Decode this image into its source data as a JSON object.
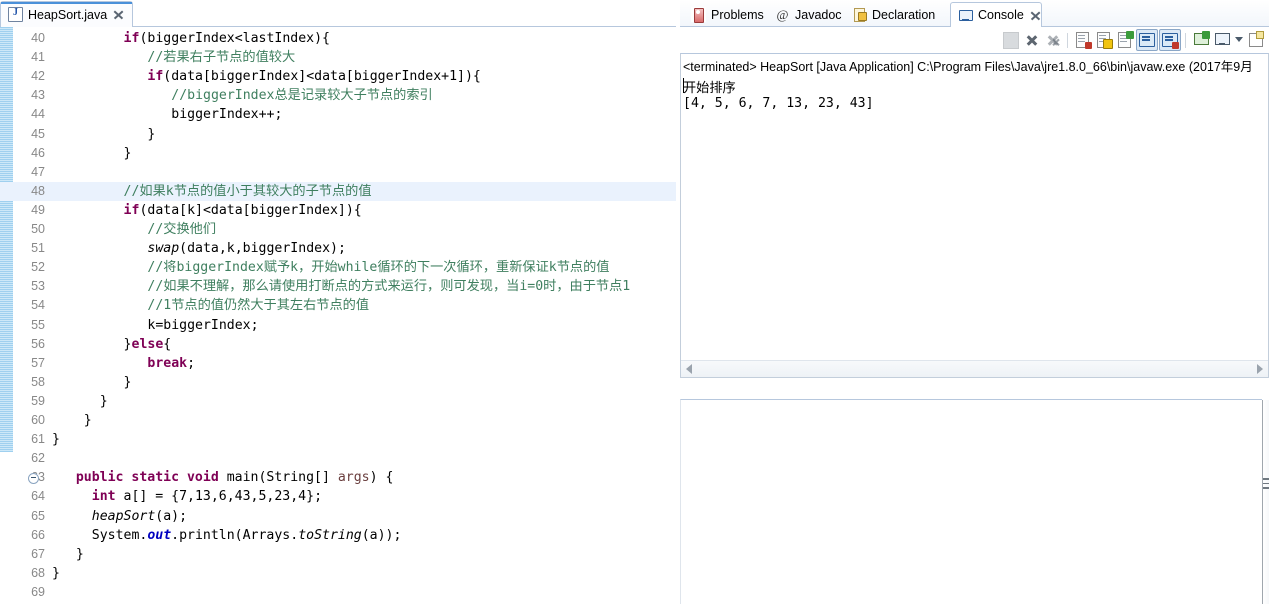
{
  "editor": {
    "tab": {
      "title": "HeapSort.java",
      "icon": "java-file-icon",
      "close_icon": "close-icon"
    },
    "lines": [
      {
        "num": "40",
        "indent": 9,
        "segments": [
          {
            "t": "if",
            "c": "kw"
          },
          {
            "t": "(biggerIndex<lastIndex){",
            "c": "pl"
          }
        ]
      },
      {
        "num": "41",
        "indent": 12,
        "segments": [
          {
            "t": "//若果右子节点的值较大",
            "c": "cm"
          }
        ]
      },
      {
        "num": "42",
        "indent": 12,
        "segments": [
          {
            "t": "if",
            "c": "kw"
          },
          {
            "t": "(data[biggerIndex]<data[biggerIndex+1]){",
            "c": "pl"
          }
        ]
      },
      {
        "num": "43",
        "indent": 15,
        "segments": [
          {
            "t": "//biggerIndex总是记录较大子节点的索引",
            "c": "cm"
          }
        ]
      },
      {
        "num": "44",
        "indent": 15,
        "segments": [
          {
            "t": "biggerIndex++;",
            "c": "pl"
          }
        ]
      },
      {
        "num": "45",
        "indent": 12,
        "segments": [
          {
            "t": "}",
            "c": "pl"
          }
        ]
      },
      {
        "num": "46",
        "indent": 9,
        "segments": [
          {
            "t": "}",
            "c": "pl"
          }
        ]
      },
      {
        "num": "47",
        "indent": 0,
        "segments": []
      },
      {
        "num": "48",
        "indent": 9,
        "highlight": true,
        "segments": [
          {
            "t": "//如果k节点的值小于其较大的子节点的值",
            "c": "cm"
          }
        ]
      },
      {
        "num": "49",
        "indent": 9,
        "segments": [
          {
            "t": "if",
            "c": "kw"
          },
          {
            "t": "(data[k]<data[biggerIndex]){",
            "c": "pl"
          }
        ]
      },
      {
        "num": "50",
        "indent": 12,
        "segments": [
          {
            "t": "//交换他们",
            "c": "cm"
          }
        ]
      },
      {
        "num": "51",
        "indent": 12,
        "segments": [
          {
            "t": "swap",
            "c": "it"
          },
          {
            "t": "(data,k,biggerIndex);",
            "c": "pl"
          }
        ]
      },
      {
        "num": "52",
        "indent": 12,
        "segments": [
          {
            "t": "//将biggerIndex赋予k，开始while循环的下一次循环，重新保证k节点的值",
            "c": "cm"
          }
        ]
      },
      {
        "num": "53",
        "indent": 12,
        "segments": [
          {
            "t": "//如果不理解，那么请使用打断点的方式来运行，则可发现，当i=0时，由于节点1",
            "c": "cm"
          }
        ]
      },
      {
        "num": "54",
        "indent": 12,
        "segments": [
          {
            "t": "//1节点的值仍然大于其左右节点的值",
            "c": "cm"
          }
        ]
      },
      {
        "num": "55",
        "indent": 12,
        "segments": [
          {
            "t": "k=biggerIndex;",
            "c": "pl"
          }
        ]
      },
      {
        "num": "56",
        "indent": 9,
        "segments": [
          {
            "t": "}",
            "c": "pl"
          },
          {
            "t": "else",
            "c": "kw"
          },
          {
            "t": "{",
            "c": "pl"
          }
        ]
      },
      {
        "num": "57",
        "indent": 12,
        "segments": [
          {
            "t": "break",
            "c": "kw"
          },
          {
            "t": ";",
            "c": "pl"
          }
        ]
      },
      {
        "num": "58",
        "indent": 9,
        "segments": [
          {
            "t": "}",
            "c": "pl"
          }
        ]
      },
      {
        "num": "59",
        "indent": 6,
        "segments": [
          {
            "t": "}",
            "c": "pl"
          }
        ]
      },
      {
        "num": "60",
        "indent": 4,
        "segments": [
          {
            "t": "}",
            "c": "pl"
          }
        ]
      },
      {
        "num": "61",
        "indent": 0,
        "segments": [
          {
            "t": "}",
            "c": "pl"
          }
        ]
      },
      {
        "num": "62",
        "indent": 0,
        "segments": []
      },
      {
        "num": "63",
        "indent": 3,
        "fold": true,
        "segments": [
          {
            "t": "public static void ",
            "c": "kw"
          },
          {
            "t": "main(String[] ",
            "c": "pl"
          },
          {
            "t": "args",
            "c": "par"
          },
          {
            "t": ") {",
            "c": "pl"
          }
        ]
      },
      {
        "num": "64",
        "indent": 5,
        "segments": [
          {
            "t": "int ",
            "c": "kw"
          },
          {
            "t": "a[] = {7,13,6,43,5,23,4};",
            "c": "pl"
          }
        ]
      },
      {
        "num": "65",
        "indent": 5,
        "segments": [
          {
            "t": "heapSort",
            "c": "it"
          },
          {
            "t": "(a);",
            "c": "pl"
          }
        ]
      },
      {
        "num": "66",
        "indent": 5,
        "segments": [
          {
            "t": "System.",
            "c": "pl"
          },
          {
            "t": "out",
            "c": "fld"
          },
          {
            "t": ".println(Arrays.",
            "c": "pl"
          },
          {
            "t": "toString",
            "c": "it"
          },
          {
            "t": "(a));",
            "c": "pl"
          }
        ]
      },
      {
        "num": "67",
        "indent": 3,
        "segments": [
          {
            "t": "}",
            "c": "pl"
          }
        ]
      },
      {
        "num": "68",
        "indent": 0,
        "segments": [
          {
            "t": "}",
            "c": "pl"
          }
        ]
      },
      {
        "num": "69",
        "indent": 0,
        "segments": []
      }
    ]
  },
  "console_view": {
    "tabs": [
      {
        "label": "Problems",
        "icon": "problems-icon",
        "active": false
      },
      {
        "label": "Javadoc",
        "icon": "javadoc-icon",
        "active": false
      },
      {
        "label": "Declaration",
        "icon": "declaration-icon",
        "active": false
      },
      {
        "label": "Console",
        "icon": "console-icon",
        "active": true,
        "close_icon": "close-icon"
      }
    ],
    "toolbar": [
      {
        "name": "terminate-all-icon",
        "style": "gray-doc"
      },
      {
        "name": "terminate-icon",
        "style": "x"
      },
      {
        "name": "remove-all-terminated-icon",
        "style": "xx"
      },
      {
        "name": "separator",
        "style": "sep"
      },
      {
        "name": "clear-console-icon",
        "style": "doc-x"
      },
      {
        "name": "scroll-lock-icon",
        "style": "doc-lock"
      },
      {
        "name": "word-wrap-icon",
        "style": "doc-wrap"
      },
      {
        "name": "show-console-on-output-icon",
        "style": "console-blue",
        "toggled": true
      },
      {
        "name": "show-console-on-error-icon",
        "style": "console-red",
        "toggled": true
      },
      {
        "name": "separator2",
        "style": "sep"
      },
      {
        "name": "pin-console-icon",
        "style": "pin"
      },
      {
        "name": "display-selected-console-icon",
        "style": "monitor"
      },
      {
        "name": "console-dropdown-icon",
        "style": "caret"
      },
      {
        "name": "open-console-icon",
        "style": "new-console"
      }
    ],
    "status_line": "<terminated> HeapSort [Java Application] C:\\Program Files\\Java\\jre1.8.0_66\\bin\\javaw.exe (2017年9月",
    "output": [
      "开始排序",
      "[4, 5, 6, 7, 13, 23, 43]"
    ],
    "hscroll": {
      "left_arrow": "scroll-left-icon",
      "right_arrow": "scroll-right-icon"
    }
  }
}
